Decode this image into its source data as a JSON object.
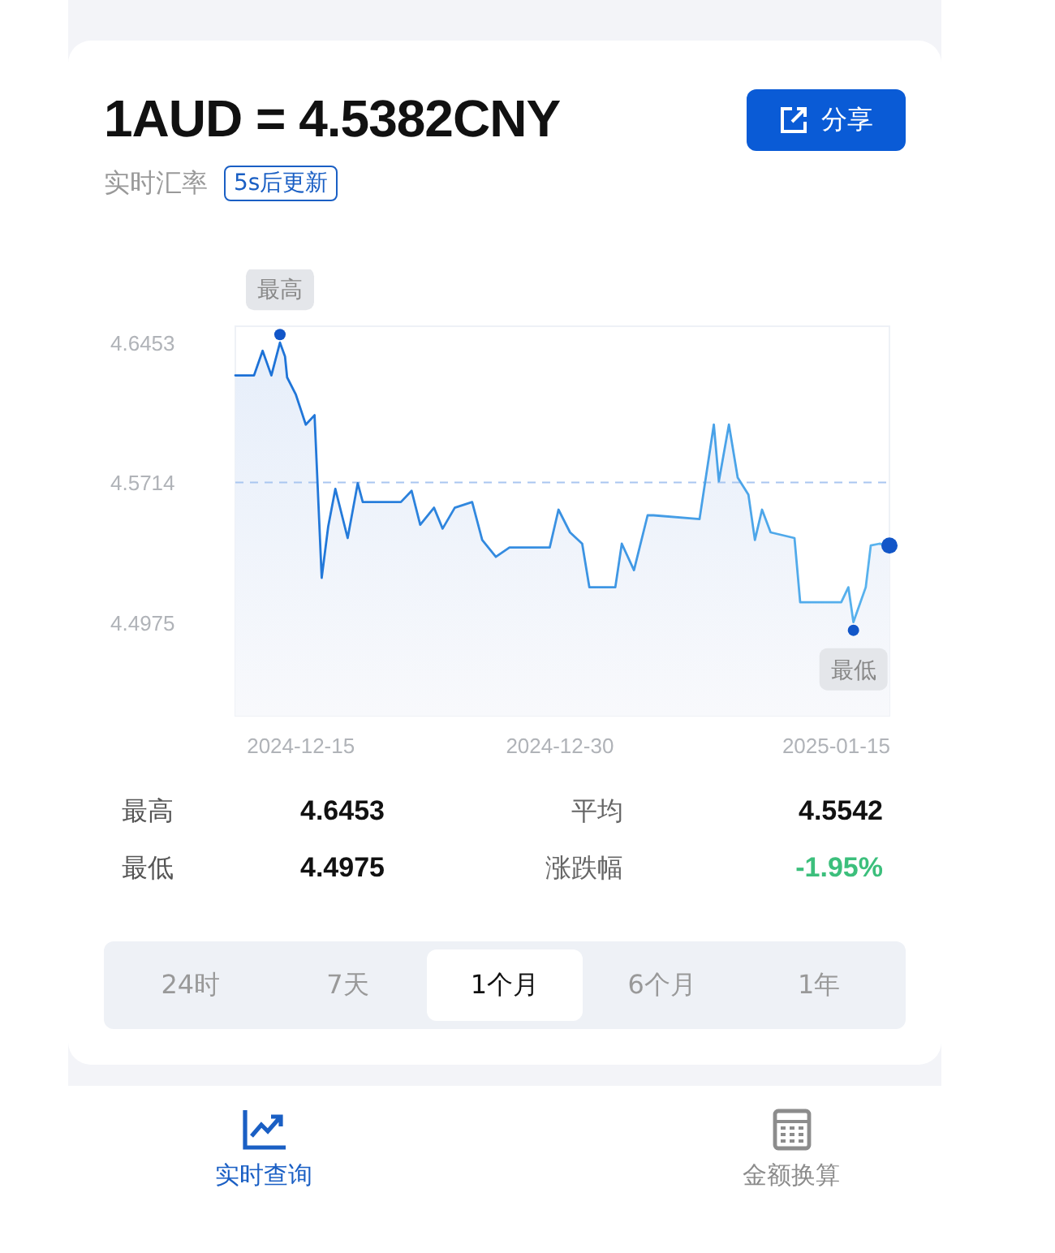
{
  "header": {
    "title": "1AUD = 4.5382CNY",
    "subtitle": "实时汇率",
    "update_tag": "5s后更新",
    "share_button": "分享"
  },
  "chart": {
    "chart_data": {
      "type": "area",
      "xlim": [
        "2024-12-11 05:00",
        "2025-01-18 02:00"
      ],
      "ylim": [
        4.448,
        4.654
      ],
      "yticks": [
        4.6453,
        4.5714,
        4.4975
      ],
      "xticks": [
        "2024-12-15",
        "2024-12-30",
        "2025-01-15"
      ],
      "x": [
        "2024-12-11 05:00",
        "2024-12-12 07:00",
        "2024-12-12 19:00",
        "2024-12-13 07:00",
        "2024-12-13 19:00",
        "2024-12-14 02:00",
        "2024-12-14 05:00",
        "2024-12-14 17:00",
        "2024-12-15 07:00",
        "2024-12-15 19:00",
        "2024-12-16 05:00",
        "2024-12-16 14:00",
        "2024-12-17 00:00",
        "2024-12-17 17:00",
        "2024-12-18 07:00",
        "2024-12-18 14:00",
        "2024-12-20 19:00",
        "2024-12-21 10:00",
        "2024-12-21 22:00",
        "2024-12-22 17:00",
        "2024-12-23 05:00",
        "2024-12-23 22:00",
        "2024-12-24 22:00",
        "2024-12-25 12:00",
        "2024-12-26 07:00",
        "2024-12-27 02:00",
        "2024-12-29 10:00",
        "2024-12-29 22:00",
        "2024-12-30 14:00",
        "2024-12-31 07:00",
        "2024-12-31 17:00",
        "2025-01-02 05:00",
        "2025-01-02 14:00",
        "2025-01-03 07:00",
        "2025-01-04 02:00",
        "2025-01-04 10:00",
        "2025-01-07 02:00",
        "2025-01-07 22:00",
        "2025-01-08 05:00",
        "2025-01-08 19:00",
        "2025-01-09 07:00",
        "2025-01-09 22:00",
        "2025-01-10 07:00",
        "2025-01-10 17:00",
        "2025-01-11 05:00",
        "2025-01-12 14:00",
        "2025-01-12 22:00",
        "2025-01-15 07:00",
        "2025-01-15 17:00",
        "2025-01-16 00:00",
        "2025-01-16 17:00",
        "2025-01-17 00:00",
        "2025-01-17 12:00",
        "2025-01-18 02:00"
      ],
      "series": [
        {
          "color": "#1a6fd6",
          "values": [
            4.628,
            4.628,
            4.641,
            4.628,
            4.6453,
            4.638,
            4.627,
            4.618,
            4.602,
            4.607,
            4.521,
            4.548,
            4.568,
            4.542,
            4.571,
            4.561,
            4.561,
            4.567,
            4.549,
            4.558,
            4.547,
            4.558,
            4.561,
            4.541,
            4.532,
            4.537,
            4.537,
            4.557,
            4.545,
            4.539,
            4.516,
            4.516,
            4.539,
            4.525,
            4.554,
            4.554,
            4.552,
            4.602,
            4.572,
            4.602,
            4.574,
            4.565,
            4.541,
            4.557,
            4.545,
            4.542,
            4.508,
            4.508,
            4.516,
            4.4975,
            4.516,
            4.538,
            4.539,
            4.538
          ]
        }
      ],
      "ref_lines": [
        {
          "axis": "y",
          "value": 4.5714
        }
      ],
      "annotations": [
        {
          "text": "最高",
          "x": "2024-12-13 19:00",
          "y": 4.6453
        },
        {
          "text": "最低",
          "x": "2025-01-16 00:00",
          "y": 4.4975
        }
      ]
    }
  },
  "stats": [
    {
      "label": "最高",
      "value": "4.6453"
    },
    {
      "label": "平均",
      "value": "4.5542"
    },
    {
      "label": "最低",
      "value": "4.4975"
    },
    {
      "label": "涨跌幅",
      "value": "-1.95%",
      "color": "#3cbf7c"
    }
  ],
  "periods": [
    {
      "label": "24时",
      "selected": false
    },
    {
      "label": "7天",
      "selected": false
    },
    {
      "label": "1个月",
      "selected": true
    },
    {
      "label": "6个月",
      "selected": false
    },
    {
      "label": "1年",
      "selected": false
    }
  ],
  "bottom_nav": [
    {
      "label": "实时查询",
      "kind": "chart",
      "selected": true
    },
    {
      "label": "金额换算",
      "kind": "calculator",
      "selected": false
    }
  ]
}
